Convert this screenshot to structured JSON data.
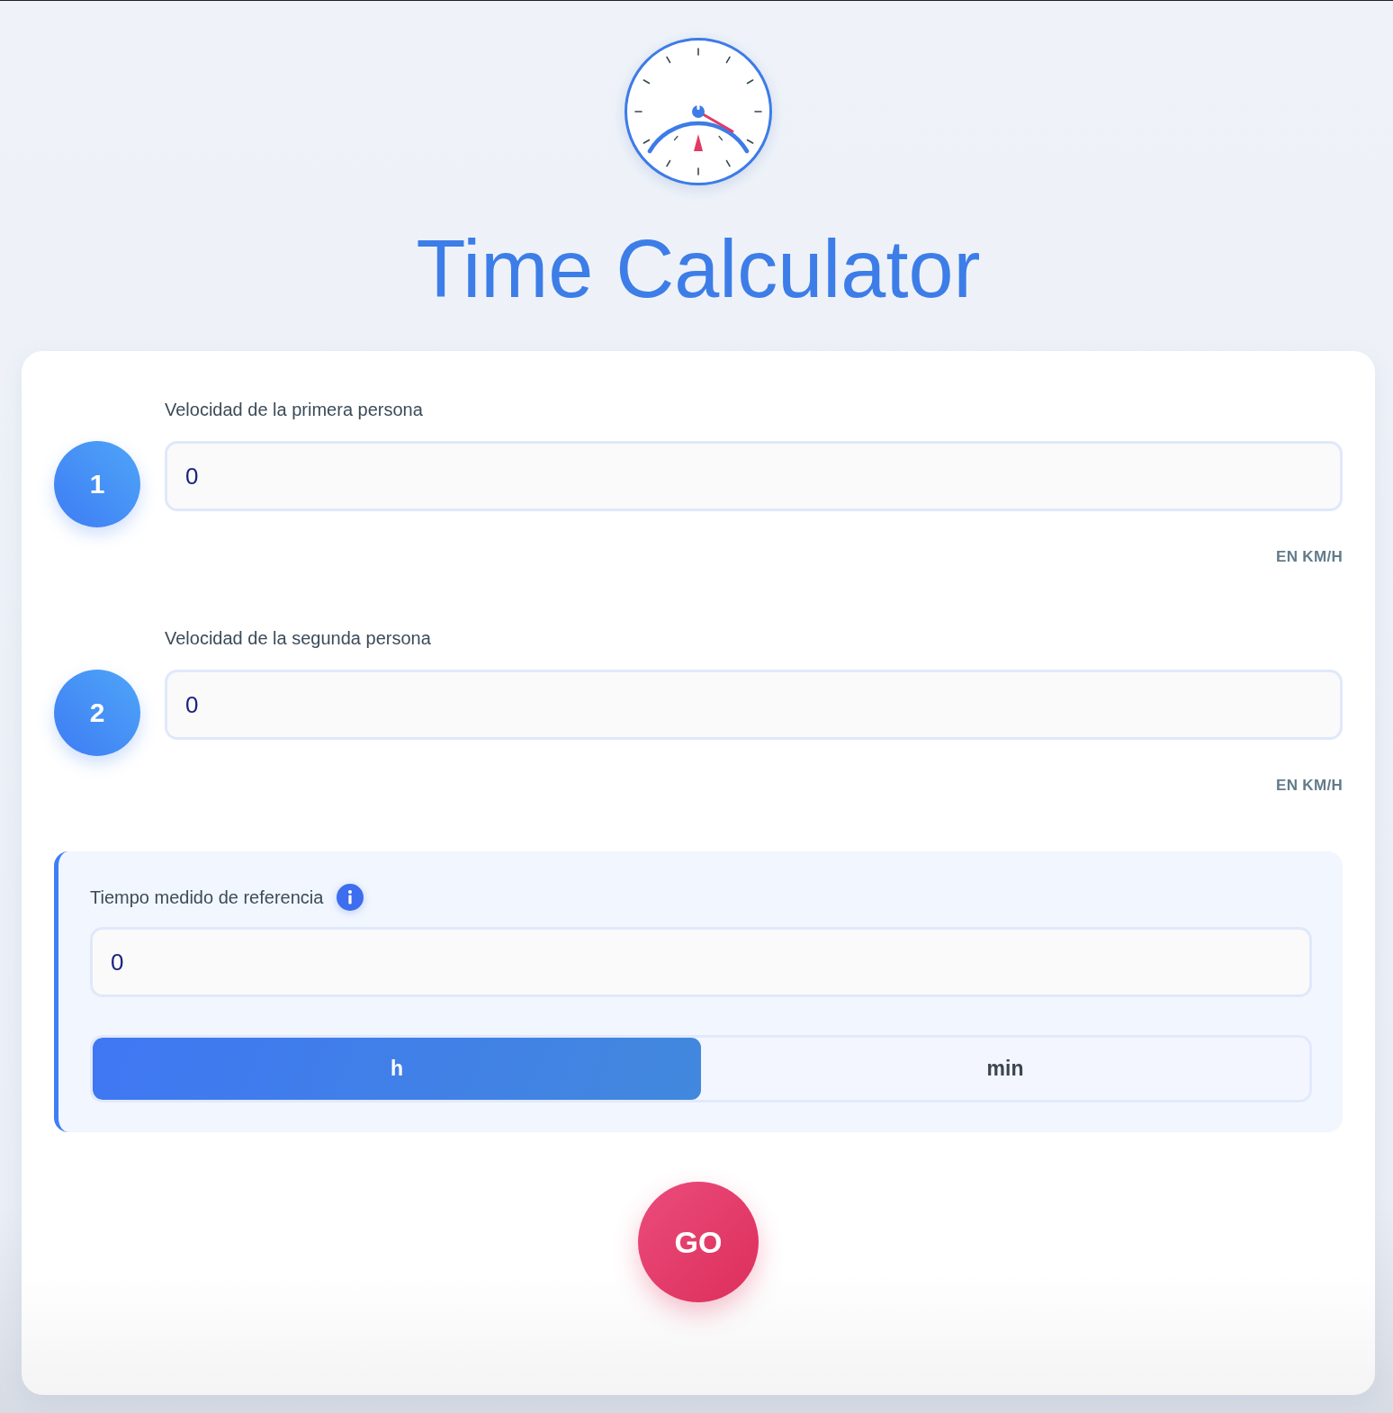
{
  "title": "Time Calculator",
  "speeds": [
    {
      "step": "1",
      "label": "Velocidad de la primera persona",
      "value": "0",
      "unit": "EN KM/H"
    },
    {
      "step": "2",
      "label": "Velocidad de la segunda persona",
      "value": "0",
      "unit": "EN KM/H"
    }
  ],
  "reference": {
    "label": "Tiempo medido de referencia",
    "value": "0",
    "units": [
      {
        "label": "h",
        "selected": true
      },
      {
        "label": "min",
        "selected": false
      }
    ]
  },
  "go_button": "GO"
}
